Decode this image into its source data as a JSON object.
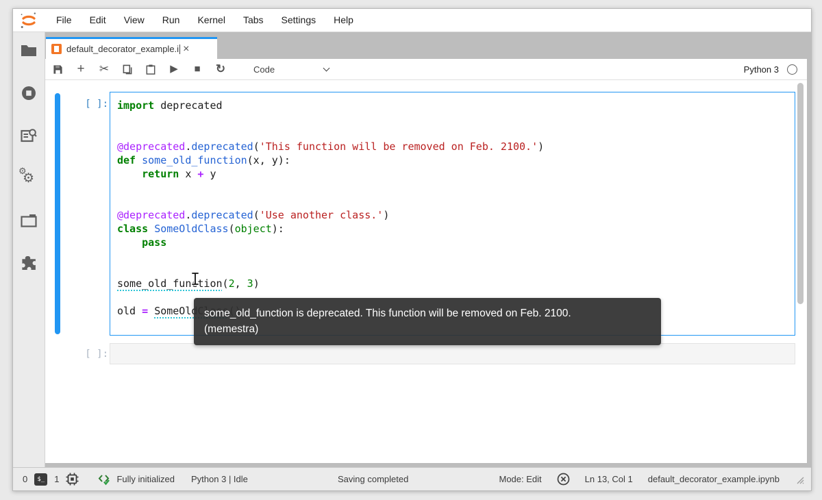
{
  "menubar": {
    "items": [
      "File",
      "Edit",
      "View",
      "Run",
      "Kernel",
      "Tabs",
      "Settings",
      "Help"
    ]
  },
  "tab": {
    "title": "default_decorator_example.i",
    "close_label": "×"
  },
  "toolbar": {
    "cell_type": "Code",
    "kernel_name": "Python 3",
    "plus_label": "+",
    "cut_label": "✂",
    "run_label": "▶",
    "stop_label": "■",
    "restart_label": "↻"
  },
  "sidebar": {
    "icons": [
      "file-browser",
      "running-kernels",
      "property-inspector",
      "settings-gears",
      "open-tabs",
      "extension-manager"
    ]
  },
  "cells": [
    {
      "prompt": "[ ]:"
    },
    {
      "prompt": "[ ]:"
    }
  ],
  "code": {
    "lines": [
      [
        {
          "t": "import",
          "c": "kw"
        },
        {
          "t": " deprecated",
          "c": "pl"
        }
      ],
      [],
      [],
      [
        {
          "t": "@deprecated",
          "c": "dec"
        },
        {
          "t": ".",
          "c": "pl"
        },
        {
          "t": "deprecated",
          "c": "fn"
        },
        {
          "t": "(",
          "c": "pl"
        },
        {
          "t": "'This function will be removed on Feb. 2100.'",
          "c": "str"
        },
        {
          "t": ")",
          "c": "pl"
        }
      ],
      [
        {
          "t": "def",
          "c": "kw"
        },
        {
          "t": " ",
          "c": "pl"
        },
        {
          "t": "some_old_function",
          "c": "fn"
        },
        {
          "t": "(x, y):",
          "c": "pl"
        }
      ],
      [
        {
          "t": "    ",
          "c": "pl"
        },
        {
          "t": "return",
          "c": "kw"
        },
        {
          "t": " x ",
          "c": "pl"
        },
        {
          "t": "+",
          "c": "op"
        },
        {
          "t": " y",
          "c": "pl"
        }
      ],
      [],
      [],
      [
        {
          "t": "@deprecated",
          "c": "dec"
        },
        {
          "t": ".",
          "c": "pl"
        },
        {
          "t": "deprecated",
          "c": "fn"
        },
        {
          "t": "(",
          "c": "pl"
        },
        {
          "t": "'Use another class.'",
          "c": "str"
        },
        {
          "t": ")",
          "c": "pl"
        }
      ],
      [
        {
          "t": "class",
          "c": "kw"
        },
        {
          "t": " ",
          "c": "pl"
        },
        {
          "t": "SomeOldClass",
          "c": "fn"
        },
        {
          "t": "(",
          "c": "pl"
        },
        {
          "t": "object",
          "c": "bi"
        },
        {
          "t": "):",
          "c": "pl"
        }
      ],
      [
        {
          "t": "    ",
          "c": "pl"
        },
        {
          "t": "pass",
          "c": "kw"
        }
      ],
      [],
      [],
      [
        {
          "t": "some_old_function",
          "c": "dep"
        },
        {
          "t": "(",
          "c": "pl"
        },
        {
          "t": "2",
          "c": "num"
        },
        {
          "t": ", ",
          "c": "pl"
        },
        {
          "t": "3",
          "c": "num"
        },
        {
          "t": ")",
          "c": "pl"
        }
      ],
      [],
      [
        {
          "t": "old ",
          "c": "pl"
        },
        {
          "t": "=",
          "c": "op"
        },
        {
          "t": " ",
          "c": "pl"
        },
        {
          "t": "SomeOldClass",
          "c": "dep"
        },
        {
          "t": "()",
          "c": "pl"
        }
      ]
    ]
  },
  "tooltip": {
    "line1": "some_old_function is deprecated. This function will be removed on Feb. 2100.",
    "line2": "(memestra)"
  },
  "statusbar": {
    "terminals_count": "0",
    "terminal_icon_label": "$_",
    "kernels_count": "1",
    "lsp_status": "Fully initialized",
    "kernel_status": "Python 3 | Idle",
    "save_status": "Saving completed",
    "mode": "Mode: Edit",
    "cursor_position": "Ln 13, Col 1",
    "filename": "default_decorator_example.ipynb"
  },
  "colors": {
    "accent_blue": "#2196f3",
    "jupyter_orange": "#f37626",
    "tabbar_gray": "#bdbdbd",
    "diagnostic_underline": "#2ec4d6",
    "lsp_green": "#2e7d32"
  }
}
